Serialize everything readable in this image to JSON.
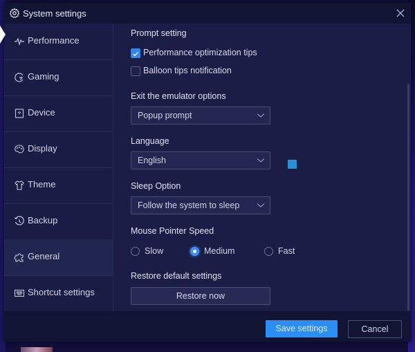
{
  "window": {
    "title": "System settings",
    "title_icon": "gear-icon",
    "close_icon": "close-icon"
  },
  "sidebar": {
    "items": [
      {
        "label": "Performance",
        "icon": "performance-pulse-icon",
        "active": false
      },
      {
        "label": "Gaming",
        "icon": "gaming-icon",
        "active": false
      },
      {
        "label": "Device",
        "icon": "device-icon",
        "active": false
      },
      {
        "label": "Display",
        "icon": "palette-icon",
        "active": false
      },
      {
        "label": "Theme",
        "icon": "shirt-icon",
        "active": false
      },
      {
        "label": "Backup",
        "icon": "history-icon",
        "active": false
      },
      {
        "label": "General",
        "icon": "puzzle-icon",
        "active": true
      },
      {
        "label": "Shortcut settings",
        "icon": "keyboard-icon",
        "active": false
      }
    ]
  },
  "content": {
    "prompt_setting": {
      "label": "Prompt setting",
      "options": [
        {
          "label": "Performance optimization tips",
          "checked": true
        },
        {
          "label": "Balloon tips notification",
          "checked": false
        }
      ]
    },
    "exit_options": {
      "label": "Exit the emulator options",
      "value": "Popup prompt"
    },
    "language": {
      "label": "Language",
      "value": "English"
    },
    "sleep_option": {
      "label": "Sleep Option",
      "value": "Follow the system to sleep"
    },
    "mouse_speed": {
      "label": "Mouse Pointer Speed",
      "options": [
        "Slow",
        "Medium",
        "Fast"
      ],
      "selected": "Medium"
    },
    "restore": {
      "label": "Restore default settings",
      "button": "Restore now"
    }
  },
  "footer": {
    "save_label": "Save settings",
    "cancel_label": "Cancel"
  },
  "colors": {
    "accent": "#2a8ef5",
    "background": "#1a1d45",
    "sidebar": "#191c44",
    "titlebar": "#121433"
  }
}
